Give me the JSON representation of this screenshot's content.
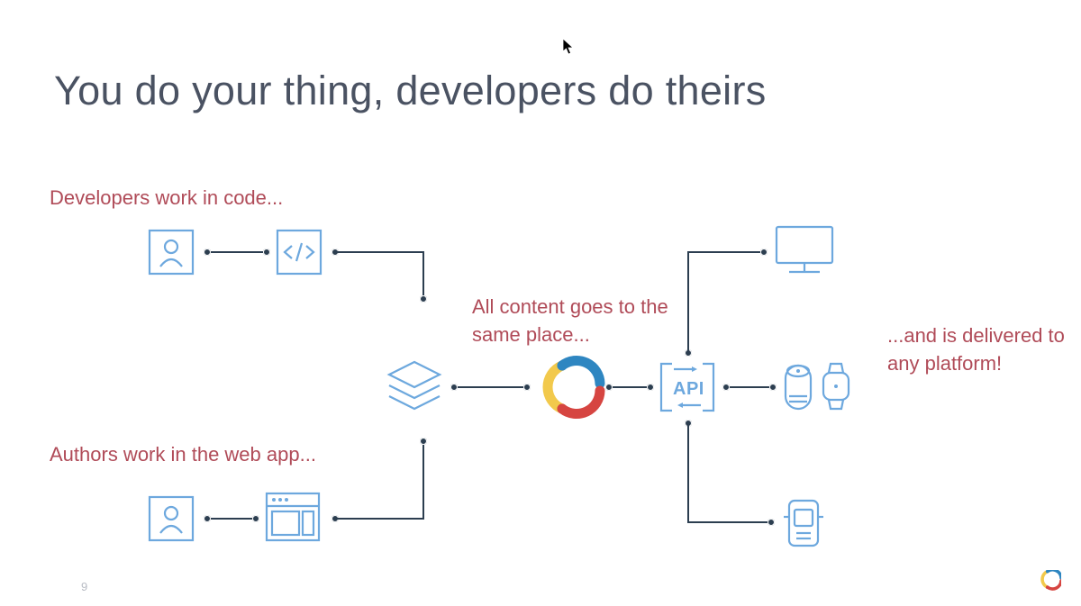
{
  "slide": {
    "title": "You do your thing, developers do theirs",
    "page_number": "9"
  },
  "labels": {
    "developers": "Developers work in code...",
    "authors": "Authors work in the web app...",
    "center": "All content goes to the same place...",
    "right": "...and is delivered to any platform!"
  },
  "api_label": "API",
  "icons": {
    "person": "person-icon",
    "code": "code-icon",
    "webapp": "webapp-icon",
    "layers": "layers-icon",
    "logo": "contentful-logo",
    "api": "api-icon",
    "desktop": "desktop-icon",
    "smart_speaker": "smart-speaker-icon",
    "watch": "watch-icon",
    "mobile": "mobile-device-icon"
  },
  "colors": {
    "blue": "#6da8de",
    "nav": "#2c3e50",
    "maroon": "#b04b58",
    "grey_text": "#4a5262",
    "logo_yellow": "#f2c94c",
    "logo_red": "#d64541",
    "logo_blue": "#2e86c1"
  }
}
